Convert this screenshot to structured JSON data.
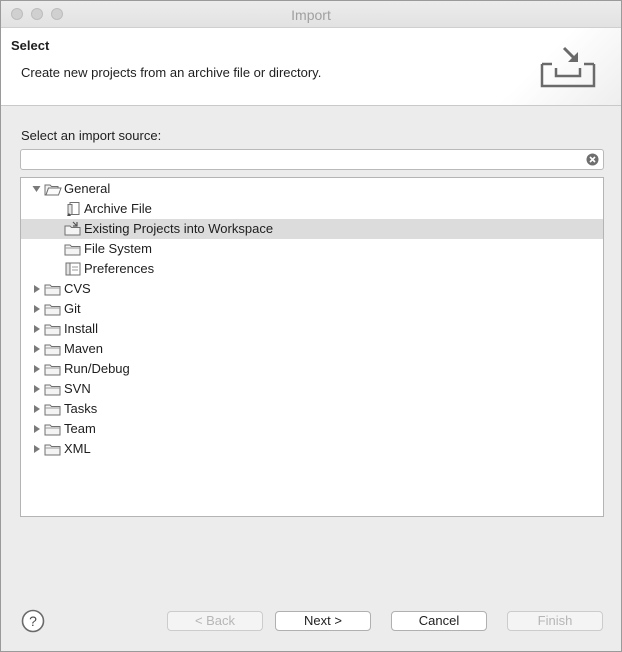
{
  "window": {
    "title": "Import"
  },
  "header": {
    "title": "Select",
    "description": "Create new projects from an archive file or directory."
  },
  "source": {
    "label": "Select an import source:",
    "filter_value": "",
    "filter_placeholder": ""
  },
  "tree": [
    {
      "label": "General",
      "expanded": true,
      "depth": 0,
      "icon": "folder-open-icon"
    },
    {
      "label": "Archive File",
      "depth": 1,
      "icon": "archive-file-icon"
    },
    {
      "label": "Existing Projects into Workspace",
      "depth": 1,
      "icon": "existing-projects-icon",
      "selected": true
    },
    {
      "label": "File System",
      "depth": 1,
      "icon": "folder-icon"
    },
    {
      "label": "Preferences",
      "depth": 1,
      "icon": "preferences-icon"
    },
    {
      "label": "CVS",
      "expanded": false,
      "depth": 0,
      "icon": "folder-icon"
    },
    {
      "label": "Git",
      "expanded": false,
      "depth": 0,
      "icon": "folder-icon"
    },
    {
      "label": "Install",
      "expanded": false,
      "depth": 0,
      "icon": "folder-icon"
    },
    {
      "label": "Maven",
      "expanded": false,
      "depth": 0,
      "icon": "folder-icon"
    },
    {
      "label": "Run/Debug",
      "expanded": false,
      "depth": 0,
      "icon": "folder-icon"
    },
    {
      "label": "SVN",
      "expanded": false,
      "depth": 0,
      "icon": "folder-icon"
    },
    {
      "label": "Tasks",
      "expanded": false,
      "depth": 0,
      "icon": "folder-icon"
    },
    {
      "label": "Team",
      "expanded": false,
      "depth": 0,
      "icon": "folder-icon"
    },
    {
      "label": "XML",
      "expanded": false,
      "depth": 0,
      "icon": "folder-icon"
    }
  ],
  "buttons": {
    "back": "< Back",
    "next": "Next >",
    "cancel": "Cancel",
    "finish": "Finish"
  },
  "colors": {
    "selection": "#dcdcdc",
    "disabled_text": "#b6b6b6"
  }
}
